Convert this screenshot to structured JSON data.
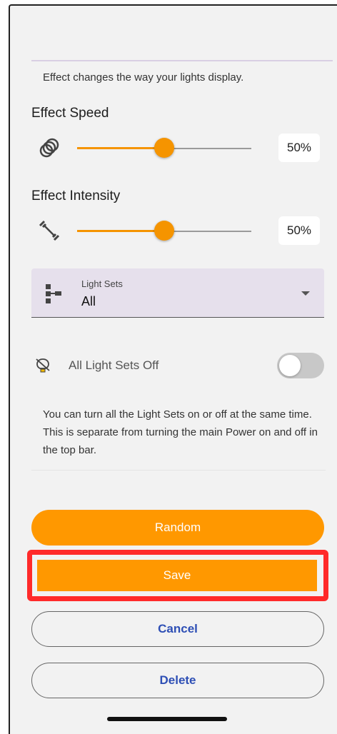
{
  "effect": {
    "description": "Effect changes the way your lights display."
  },
  "effect_speed": {
    "label": "Effect Speed",
    "value_text": "50%",
    "value": 0.5,
    "icon": "rings-icon"
  },
  "effect_intensity": {
    "label": "Effect Intensity",
    "value_text": "50%",
    "value": 0.5,
    "icon": "dumbbell-icon"
  },
  "light_sets": {
    "label": "Light Sets",
    "selected": "All",
    "icon": "hierarchy-icon"
  },
  "all_off": {
    "label": "All Light Sets Off",
    "enabled": false,
    "icon": "lightbulb-off-icon"
  },
  "help_text": "You can turn all the Light Sets on or off at the same time. This is separate from turning the main Power on and off in the top bar.",
  "buttons": {
    "random": "Random",
    "save": "Save",
    "cancel": "Cancel",
    "delete": "Delete"
  },
  "colors": {
    "accent": "#ff9800",
    "highlight": "#ff2a2a",
    "link_text": "#2e4fb5"
  }
}
